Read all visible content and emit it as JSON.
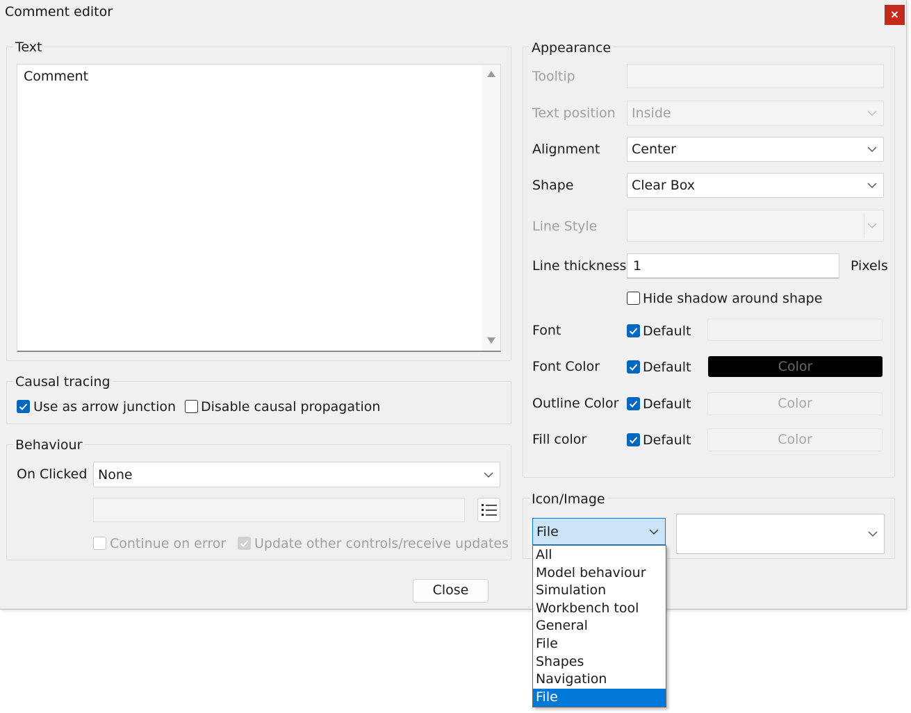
{
  "window": {
    "title": "Comment editor",
    "close_glyph": "×"
  },
  "text_group": {
    "label": "Text",
    "content": "Comment"
  },
  "causal_tracing": {
    "label": "Causal tracing",
    "use_arrow_junction": {
      "label": "Use as arrow junction",
      "checked": true
    },
    "disable_propagation": {
      "label": "Disable causal propagation",
      "checked": false
    }
  },
  "behaviour": {
    "label": "Behaviour",
    "on_clicked_label": "On Clicked",
    "on_clicked_value": "None",
    "action_value": "",
    "continue_on_error": {
      "label": "Continue on error",
      "checked": false,
      "enabled": false
    },
    "update_controls": {
      "label": "Update other controls/receive updates",
      "checked": true,
      "enabled": false
    }
  },
  "appearance": {
    "label": "Appearance",
    "tooltip_label": "Tooltip",
    "tooltip_value": "",
    "text_position_label": "Text position",
    "text_position_value": "Inside",
    "alignment_label": "Alignment",
    "alignment_value": "Center",
    "shape_label": "Shape",
    "shape_value": "Clear Box",
    "line_style_label": "Line Style",
    "line_style_value": "",
    "line_thickness_label": "Line thickness",
    "line_thickness_value": "1",
    "line_thickness_unit": "Pixels",
    "hide_shadow": {
      "label": "Hide shadow around shape",
      "checked": false
    },
    "font_label": "Font",
    "font_color_label": "Font Color",
    "outline_color_label": "Outline Color",
    "fill_color_label": "Fill color",
    "default_label": "Default",
    "color_button_label": "Color",
    "font_color_swatch": "#000000"
  },
  "icon_image": {
    "label": "Icon/Image",
    "category_value": "File",
    "image_value": "",
    "dropdown_items": [
      "All",
      "Model behaviour",
      "Simulation",
      "Workbench tool",
      "General",
      "File",
      "Shapes",
      "Navigation",
      "File"
    ],
    "selected_index": 8
  },
  "footer": {
    "close_label": "Close"
  },
  "colors": {
    "accent": "#0067c0",
    "selection": "#0078d7",
    "close_red": "#c42b1c"
  }
}
